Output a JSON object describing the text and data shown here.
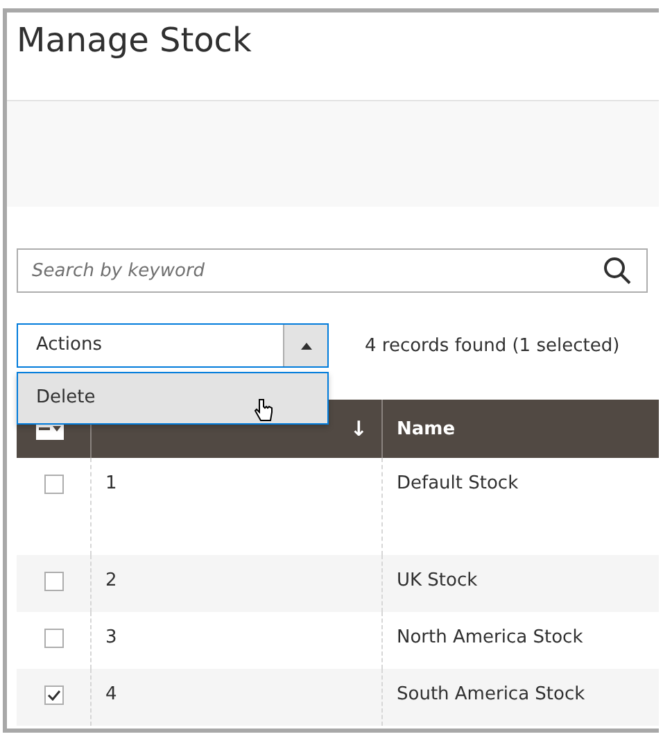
{
  "title": "Manage Stock",
  "search": {
    "placeholder": "Search by keyword"
  },
  "actions": {
    "label": "Actions",
    "expanded": true,
    "options": [
      {
        "label": "Delete",
        "selected": true
      }
    ]
  },
  "records_found": "4 records found (1 selected)",
  "table": {
    "columns": [
      {
        "sort": "↓"
      },
      {
        "label": "Name"
      }
    ],
    "rows": [
      {
        "checked": false,
        "id": "1",
        "name": "Default Stock",
        "tall": true
      },
      {
        "checked": false,
        "id": "2",
        "name": "UK Stock",
        "tall": false
      },
      {
        "checked": false,
        "id": "3",
        "name": "North America Stock",
        "tall": false
      },
      {
        "checked": true,
        "id": "4",
        "name": "South America Stock",
        "tall": false
      }
    ]
  }
}
